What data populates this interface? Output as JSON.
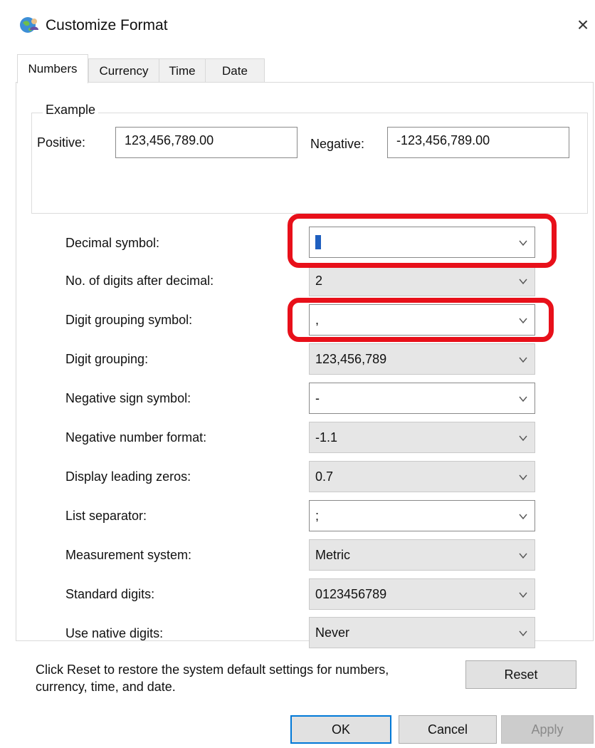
{
  "window": {
    "title": "Customize Format",
    "close_glyph": "×",
    "app_icon": "globe-user-icon"
  },
  "tabs": [
    {
      "label": "Numbers",
      "active": true
    },
    {
      "label": "Currency",
      "active": false
    },
    {
      "label": "Time",
      "active": false
    },
    {
      "label": "Date",
      "active": false
    }
  ],
  "example": {
    "legend": "Example",
    "positive_label": "Positive:",
    "positive_value": "123,456,789.00",
    "negative_label": "Negative:",
    "negative_value": "-123,456,789.00"
  },
  "settings": [
    {
      "label": "Decimal symbol:",
      "value": "",
      "editable": true,
      "highlighted": true,
      "text_cursor": true
    },
    {
      "label": "No. of digits after decimal:",
      "value": "2",
      "editable": false
    },
    {
      "label": "Digit grouping symbol:",
      "value": ",",
      "editable": true,
      "highlighted": true
    },
    {
      "label": "Digit grouping:",
      "value": "123,456,789",
      "editable": false
    },
    {
      "label": "Negative sign symbol:",
      "value": "-",
      "editable": true
    },
    {
      "label": "Negative number format:",
      "value": "-1.1",
      "editable": false
    },
    {
      "label": "Display leading zeros:",
      "value": "0.7",
      "editable": false
    },
    {
      "label": "List separator:",
      "value": ";",
      "editable": true
    },
    {
      "label": "Measurement system:",
      "value": "Metric",
      "editable": false
    },
    {
      "label": "Standard digits:",
      "value": "0123456789",
      "editable": false
    },
    {
      "label": "Use native digits:",
      "value": "Never",
      "editable": false
    }
  ],
  "footer": {
    "reset_note": "Click Reset to restore the system default settings for numbers, currency, time, and date.",
    "reset_label": "Reset",
    "ok_label": "OK",
    "cancel_label": "Cancel",
    "apply_label": "Apply",
    "apply_enabled": false
  },
  "colors": {
    "highlight": "#e8101a",
    "default_button_border": "#0078d7",
    "readonly_combo_bg": "#e6e6e6"
  }
}
